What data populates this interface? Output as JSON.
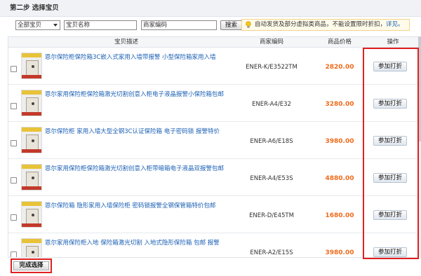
{
  "step": {
    "title": "第二步 选择宝贝"
  },
  "search": {
    "category": "全部宝贝",
    "name_value": "宝贝名称",
    "code_value": "商家编码",
    "button_label": "搜索"
  },
  "notice": {
    "text": "自动发货及部分虚拟类商品，不能设置限时折扣，",
    "link": "详见。"
  },
  "table": {
    "headers": {
      "desc": "宝贝描述",
      "code": "商家编码",
      "price": "商品价格",
      "action": "操作"
    },
    "rows": [
      {
        "title": "恩尔保险柜保险箱3C嵌入式家用入墙带报警 小型保险箱家用入墙",
        "code": "ENER-K/E3522TM",
        "price": "2820.00",
        "action": "参加打折"
      },
      {
        "title": "恩尔家用保险柜保险箱激光切割创意入柜电子液晶报警小保险箱包邮",
        "code": "ENER-A4/E32",
        "price": "3280.00",
        "action": "参加打折"
      },
      {
        "title": "恩尔保险柜 家用入墙大型全钢3C认证保险箱 电子密码锁 报警特价",
        "code": "ENER-A6/E18S",
        "price": "3980.00",
        "action": "参加打折"
      },
      {
        "title": "恩尔家用保险柜保险箱激光切割创意入柜带暗箱电子液晶双报警包邮",
        "code": "ENER-A4/E53S",
        "price": "4880.00",
        "action": "参加打折"
      },
      {
        "title": "恩尔保险箱 隐形家用入墙保险柜 密码锁报警全钢保管箱特价包邮",
        "code": "ENER-D/E45TM",
        "price": "1680.00",
        "action": "参加打折"
      },
      {
        "title": "恩尔家用保险柜入地 保险箱激光切割 入地式隐形保险箱 包邮 报警",
        "code": "ENER-A2/E15S",
        "price": "3980.00",
        "action": "参加打折"
      }
    ]
  },
  "footer": {
    "done_label": "完成选择"
  },
  "colors": {
    "link": "#1a5fb4",
    "price": "#f06a1a",
    "highlight": "#e02020"
  }
}
